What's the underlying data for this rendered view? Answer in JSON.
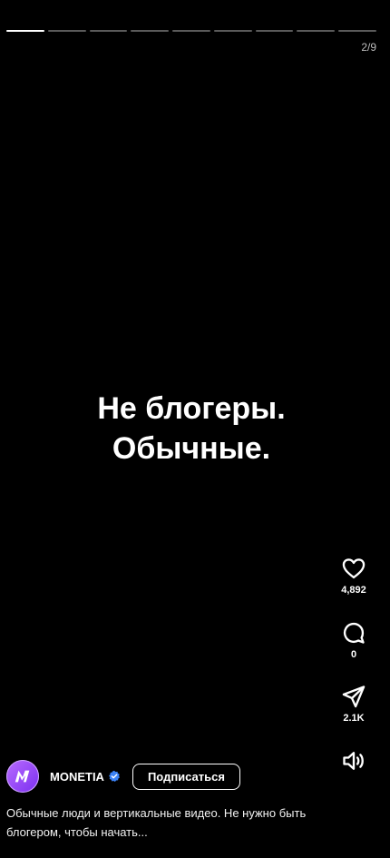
{
  "story": {
    "counter": "2/9",
    "headline_line1": "Не блогеры.",
    "headline_line2": "Обычные."
  },
  "actions": {
    "likes": "4,892",
    "comments": "0",
    "shares": "2.1K"
  },
  "author": {
    "name": "MONETIA",
    "follow_label": "Подписаться",
    "avatar_letter": "M"
  },
  "caption": "Обычные люди и вертикальные видео. Не нужно быть блогером, чтобы начать...",
  "colors": {
    "background": "#000000",
    "progress_active": "#ffffff",
    "progress_inactive": "#5a5a5a",
    "verified": "#3b82f6",
    "avatar": "#9b4dff"
  },
  "icons": [
    "heart-icon",
    "comment-icon",
    "share-icon",
    "volume-icon",
    "verified-icon"
  ]
}
